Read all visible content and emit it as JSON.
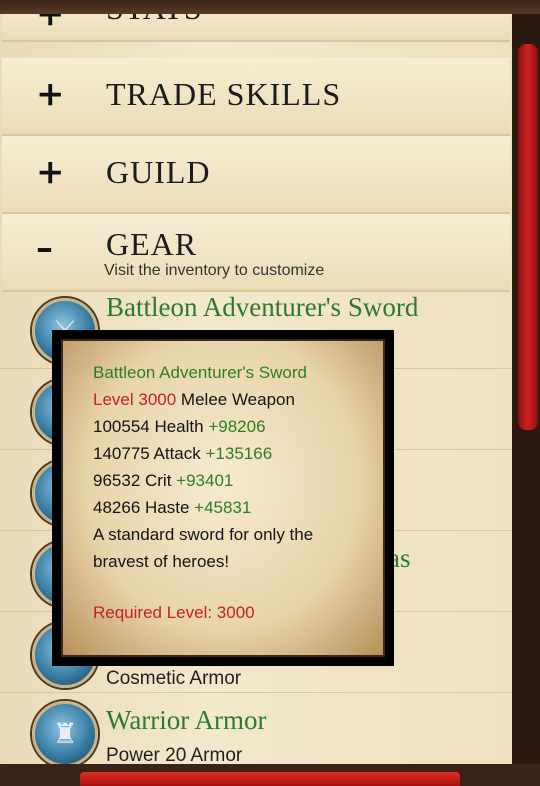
{
  "sections": {
    "stats": {
      "sign": "+",
      "title": "STATS"
    },
    "trade_skills": {
      "sign": "+",
      "title": "TRADE SKILLS"
    },
    "guild": {
      "sign": "+",
      "title": "GUILD"
    },
    "gear": {
      "sign": "–",
      "title": "GEAR",
      "subtitle": "Visit the inventory to customize"
    }
  },
  "gear_items": [
    {
      "name": "Battleon Adventurer's Sword",
      "icon": "sword-icon"
    },
    {
      "name": "",
      "icon": "item-icon"
    },
    {
      "name": "",
      "icon": "item-icon"
    },
    {
      "name": "as",
      "icon": "item-icon"
    },
    {
      "name": "",
      "sub": "Cosmetic Armor",
      "icon": "item-icon"
    },
    {
      "name": "Warrior Armor",
      "sub": "Power 20 Armor",
      "icon": "armor-icon"
    }
  ],
  "tooltip": {
    "name": "Battleon Adventurer's Sword",
    "level": "Level 3000",
    "type": "Melee Weapon",
    "stats": [
      {
        "base": "100554 Health",
        "bonus": "+98206"
      },
      {
        "base": "140775 Attack",
        "bonus": "+135166"
      },
      {
        "base": "96532 Crit",
        "bonus": "+93401"
      },
      {
        "base": "48266 Haste",
        "bonus": "+45831"
      }
    ],
    "desc1": "A standard sword for only the",
    "desc2": "bravest of heroes!",
    "required": "Required Level: 3000"
  },
  "colors": {
    "accent_green": "#2e7f22",
    "accent_red": "#c62222",
    "scrollbar": "#d02020"
  }
}
